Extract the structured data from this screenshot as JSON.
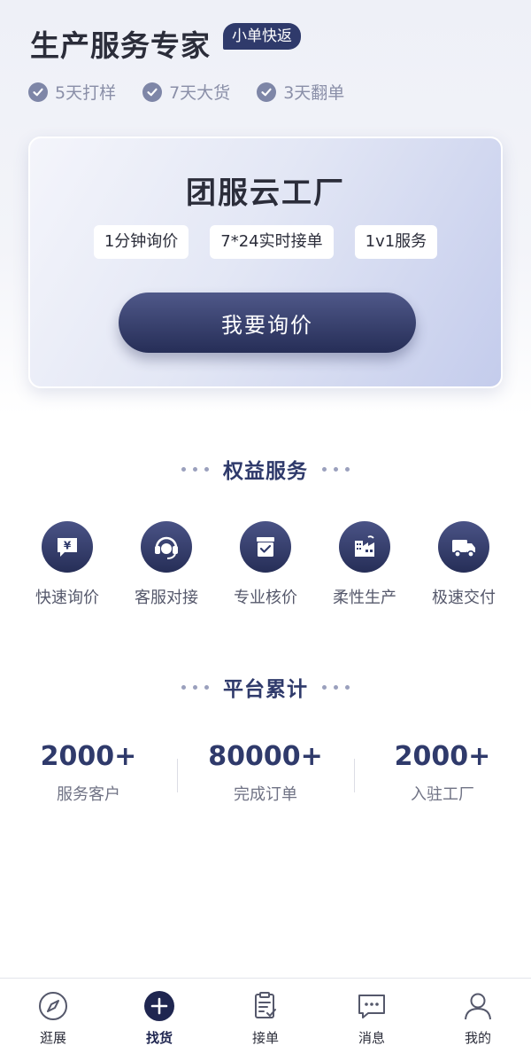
{
  "header": {
    "title": "生产服务专家",
    "badge": "小单快返",
    "features": [
      "5天打样",
      "7天大货",
      "3天翻单"
    ]
  },
  "hero": {
    "title": "团服云工厂",
    "tags": [
      "1分钟询价",
      "7*24实时接单",
      "1v1服务"
    ],
    "button_label": "我要询价"
  },
  "benefits": {
    "title": "权益服务",
    "items": [
      {
        "label": "快速询价",
        "icon": "yuan-chat-icon"
      },
      {
        "label": "客服对接",
        "icon": "headset-icon"
      },
      {
        "label": "专业核价",
        "icon": "checklist-icon"
      },
      {
        "label": "柔性生产",
        "icon": "factory-icon"
      },
      {
        "label": "极速交付",
        "icon": "truck-icon"
      }
    ]
  },
  "stats": {
    "title": "平台累计",
    "items": [
      {
        "value": "2000+",
        "label": "服务客户"
      },
      {
        "value": "80000+",
        "label": "完成订单"
      },
      {
        "value": "2000+",
        "label": "入驻工厂"
      }
    ]
  },
  "tabbar": {
    "active": "找货",
    "items": [
      {
        "label": "逛展",
        "icon": "compass-icon"
      },
      {
        "label": "找货",
        "icon": "plus-circle-icon"
      },
      {
        "label": "接单",
        "icon": "clipboard-icon"
      },
      {
        "label": "消息",
        "icon": "message-icon"
      },
      {
        "label": "我的",
        "icon": "user-icon"
      }
    ]
  },
  "colors": {
    "brand": "#2f3a6b",
    "brand_dark": "#262e57",
    "muted": "#8a8fa8"
  }
}
